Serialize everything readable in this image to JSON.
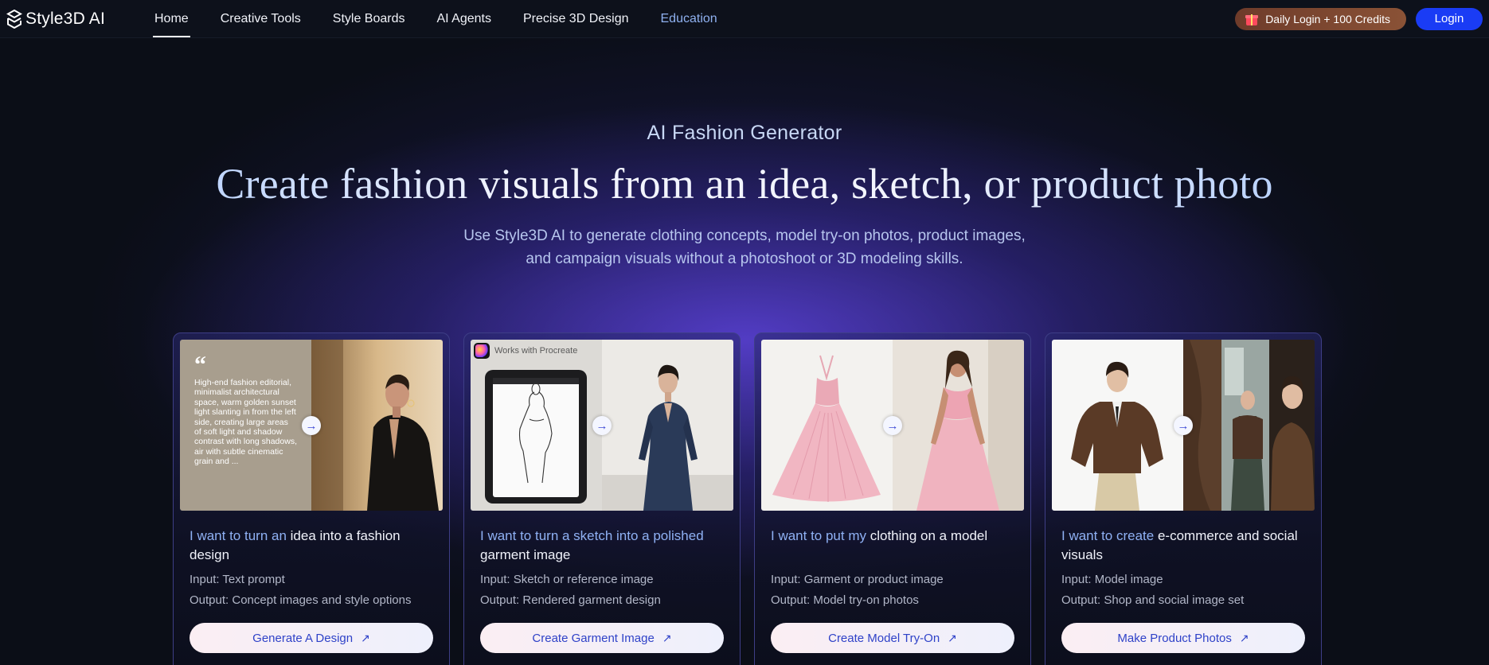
{
  "nav": {
    "logo_text": "Style3D AI",
    "items": [
      {
        "label": "Home",
        "active": true
      },
      {
        "label": "Creative Tools"
      },
      {
        "label": "Style Boards"
      },
      {
        "label": "AI Agents"
      },
      {
        "label": "Precise 3D Design"
      },
      {
        "label": "Education"
      }
    ],
    "credits_label": "Daily Login + 100 Credits",
    "login_label": "Login"
  },
  "hero": {
    "eyebrow": "AI Fashion Generator",
    "headline": "Create fashion visuals from an idea, sketch, or product photo",
    "sub_line1": "Use Style3D AI to generate clothing concepts, model try-on photos, product images,",
    "sub_line2": "and campaign visuals without a photoshoot or 3D modeling skills."
  },
  "cards": [
    {
      "prompt_text": "High-end fashion editorial, minimalist architectural space, warm golden sunset light slanting in from the left side, creating large areas of soft light and shadow contrast with long shadows, air with subtle cinematic grain and ...",
      "title_hl": "I want to turn an",
      "title_rest": " idea into a fashion design",
      "input": "Input: Text prompt",
      "output": "Output: Concept images and style options",
      "cta": "Generate A Design"
    },
    {
      "badge": "Works with Procreate",
      "title_hl": "I want to turn a sketch into a polished",
      "title_rest": " garment image",
      "input": "Input: Sketch or reference image",
      "output": "Output: Rendered garment design",
      "cta": "Create Garment Image"
    },
    {
      "title_hl": "I want to put my",
      "title_rest": " clothing on a model",
      "input": "Input: Garment or product image",
      "output": "Output: Model try-on photos",
      "cta": "Create Model Try-On"
    },
    {
      "title_hl": "I want to create",
      "title_rest": " e-commerce and social visuals",
      "input": "Input: Model image",
      "output": "Output: Shop and social image set",
      "cta": "Make Product Photos"
    }
  ],
  "icons": {
    "arrow": "→",
    "external": "↗",
    "quote": "“"
  }
}
